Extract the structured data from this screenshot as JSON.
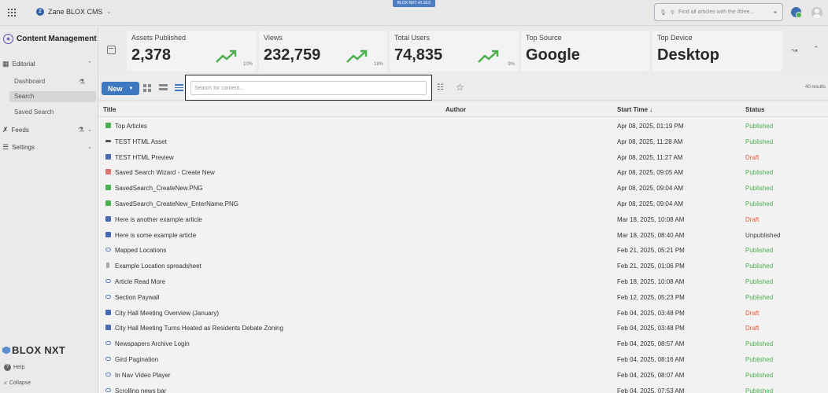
{
  "topbar": {
    "site_name": "Zane BLOX CMS",
    "site_logo_letter": "Z",
    "version": "BLOX NXT v0.18.0",
    "search_placeholder": "Find all articles with the #tree..."
  },
  "sidebar": {
    "app_title": "Content Management",
    "sections": [
      {
        "label": "Editorial",
        "items": [
          {
            "label": "Dashboard"
          },
          {
            "label": "Search",
            "active": true
          },
          {
            "label": "Saved Search"
          }
        ]
      },
      {
        "label": "Feeds"
      },
      {
        "label": "Settings"
      }
    ],
    "brand": "BLOX NXT",
    "help": "Help",
    "collapse": "Collapse"
  },
  "stats": [
    {
      "label": "Assets Published",
      "value": "2,378",
      "pct": "10%",
      "trend_color": "#4caf50"
    },
    {
      "label": "Views",
      "value": "232,759",
      "pct": "18%",
      "trend_color": "#4caf50"
    },
    {
      "label": "Total Users",
      "value": "74,835",
      "pct": "9%",
      "trend_color": "#4caf50"
    },
    {
      "label": "Top Source",
      "value": "Google"
    },
    {
      "label": "Top Device",
      "value": "Desktop"
    }
  ],
  "toolbar": {
    "new_label": "New",
    "search_placeholder": "Search for content...",
    "results": "40 results"
  },
  "table": {
    "columns": {
      "title": "Title",
      "author": "Author",
      "start_time": "Start Time",
      "status": "Status"
    },
    "rows": [
      {
        "type": "image",
        "title": "Top Articles",
        "author": "",
        "start": "Apr 08, 2025, 01:19 PM",
        "status": "Published"
      },
      {
        "type": "html",
        "title": "TEST HTML Asset",
        "author": "",
        "start": "Apr 08, 2025, 11:28 AM",
        "status": "Published"
      },
      {
        "type": "article",
        "title": "TEST HTML Preview",
        "author": "",
        "start": "Apr 08, 2025, 11:27 AM",
        "status": "Draft"
      },
      {
        "type": "collection",
        "title": "Saved Search Wizard - Create New",
        "author": "",
        "start": "Apr 08, 2025, 09:05 AM",
        "status": "Published"
      },
      {
        "type": "image",
        "title": "SavedSearch_CreateNew.PNG",
        "author": "",
        "start": "Apr 08, 2025, 09:04 AM",
        "status": "Published"
      },
      {
        "type": "image",
        "title": "SavedSearch_CreateNew_EnterName.PNG",
        "author": "",
        "start": "Apr 08, 2025, 09:04 AM",
        "status": "Published"
      },
      {
        "type": "article",
        "title": "Here is another example article",
        "author": "",
        "start": "Mar 18, 2025, 10:08 AM",
        "status": "Draft"
      },
      {
        "type": "article",
        "title": "Here is some example article",
        "author": "",
        "start": "Mar 18, 2025, 08:40 AM",
        "status": "Unpublished"
      },
      {
        "type": "link",
        "title": "Mapped Locations",
        "author": "",
        "start": "Feb 21, 2025, 05:21 PM",
        "status": "Published"
      },
      {
        "type": "file",
        "title": "Example Location spreadsheet",
        "author": "",
        "start": "Feb 21, 2025, 01:06 PM",
        "status": "Published"
      },
      {
        "type": "link",
        "title": "Article Read More",
        "author": "",
        "start": "Feb 18, 2025, 10:08 AM",
        "status": "Published"
      },
      {
        "type": "link",
        "title": "Section Paywall",
        "author": "",
        "start": "Feb 12, 2025, 05:23 PM",
        "status": "Published"
      },
      {
        "type": "article",
        "title": "City Hall Meeting Overview (January)",
        "author": "",
        "start": "Feb 04, 2025, 03:48 PM",
        "status": "Draft"
      },
      {
        "type": "article",
        "title": "City Hall Meeting Turns Heated as Residents Debate Zoning",
        "author": "",
        "start": "Feb 04, 2025, 03:48 PM",
        "status": "Draft"
      },
      {
        "type": "link",
        "title": "Newspapers Archive Login",
        "author": "",
        "start": "Feb 04, 2025, 08:57 AM",
        "status": "Published"
      },
      {
        "type": "link",
        "title": "Gird Pagination",
        "author": "",
        "start": "Feb 04, 2025, 08:16 AM",
        "status": "Published"
      },
      {
        "type": "link",
        "title": "In Nav Video Player",
        "author": "",
        "start": "Feb 04, 2025, 08:07 AM",
        "status": "Published"
      },
      {
        "type": "link",
        "title": "Scrolling news bar",
        "author": "",
        "start": "Feb 04, 2025, 07:53 AM",
        "status": "Published"
      }
    ]
  },
  "icons": {
    "apps": "apps-grid-icon",
    "microphone": "microphone-icon",
    "search": "search-icon",
    "ai": "sparkle-icon",
    "calendar": "calendar-icon",
    "trend": "trending-up-icon",
    "filter": "sliders-icon",
    "star": "star-icon"
  }
}
